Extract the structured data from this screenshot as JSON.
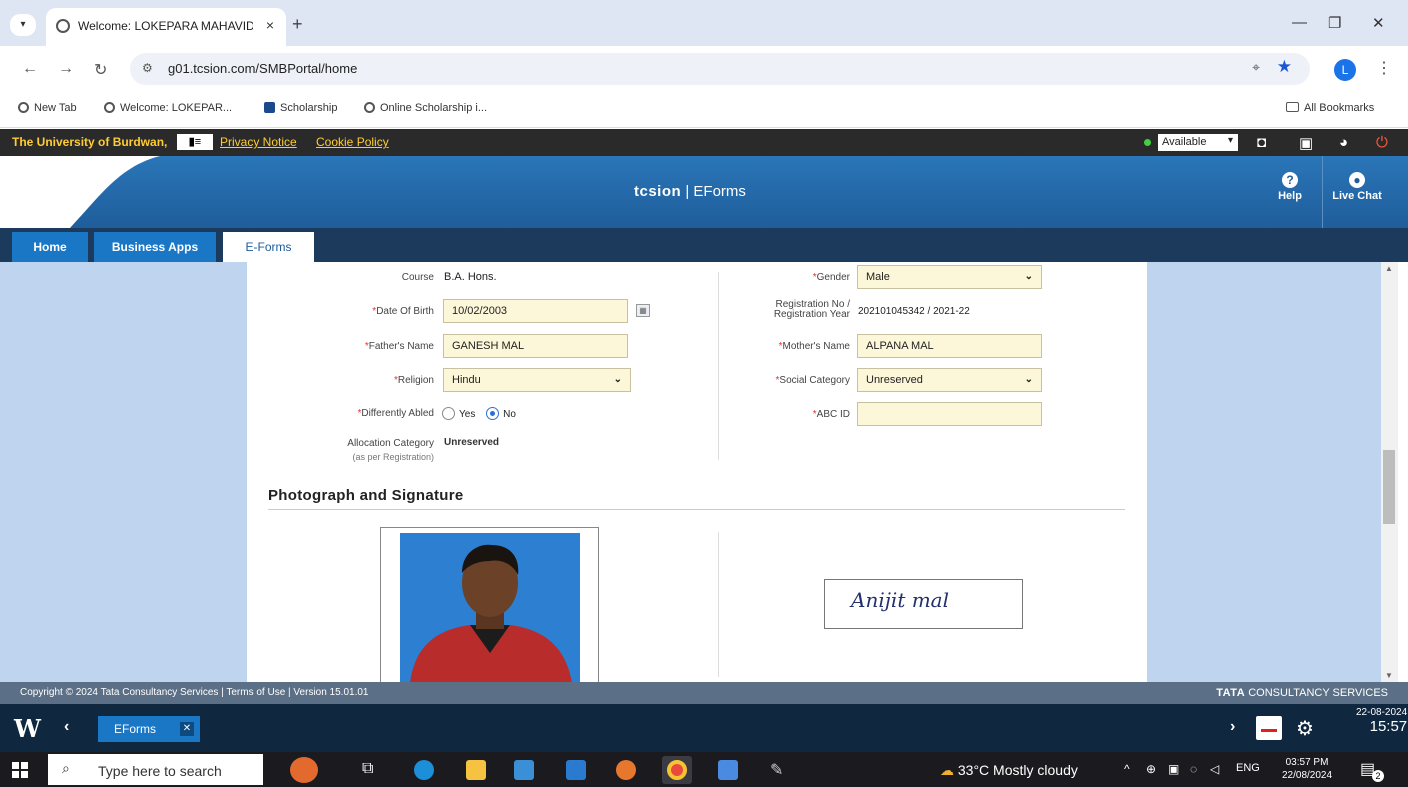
{
  "browser": {
    "tab_title": "Welcome: LOKEPARA MAHAVID",
    "tab_close": "×",
    "new_tab": "+",
    "url": "g01.tcsion.com/SMBPortal/home",
    "profile_initial": "L",
    "bookmarks": [
      "New Tab",
      "Welcome: LOKEPAR...",
      "Scholarship",
      "Online Scholarship i..."
    ],
    "all_bookmarks": "All Bookmarks"
  },
  "portal_bar": {
    "university": "The University of Burdwan,",
    "privacy": "Privacy Notice",
    "cookie": "Cookie Policy",
    "status": "Available"
  },
  "header": {
    "brand": "tcsion",
    "product": "| EForms",
    "help": "Help",
    "live_chat": "Live Chat"
  },
  "tabs": [
    "Home",
    "Business Apps",
    "E-Forms"
  ],
  "form": {
    "course_label": "Course",
    "course_value": "B.A. Hons.",
    "dob_label": "Date Of Birth",
    "dob_value": "10/02/2003",
    "father_label": "Father's Name",
    "father_value": "GANESH MAL",
    "religion_label": "Religion",
    "religion_value": "Hindu",
    "diff_label": "Differently Abled",
    "diff_yes": "Yes",
    "diff_no": "No",
    "alloc_label": "Allocation Category",
    "alloc_sub": "(as per Registration)",
    "alloc_value": "Unreserved",
    "gender_label": "Gender",
    "gender_value": "Male",
    "regno_label1": "Registration No /",
    "regno_label2": "Registration Year",
    "regno_value": "202101045342 / 2021-22",
    "mother_label": "Mother's Name",
    "mother_value": "ALPANA MAL",
    "social_label": "Social Category",
    "social_value": "Unreserved",
    "abc_label": "ABC ID",
    "abc_value": ""
  },
  "section_title": "Photograph and Signature",
  "signature_text": "Anijit mal",
  "footer": {
    "copyright": "Copyright © 2024 Tata Consultancy Services | Terms of Use | Version 15.01.01",
    "tcs_bold": "TATA",
    "tcs_rest": " CONSULTANCY SERVICES"
  },
  "app_taskbar": {
    "tab_label": "EForms",
    "date": "22-08-2024",
    "time": "15:57"
  },
  "win_taskbar": {
    "search_placeholder": "Type here to search",
    "weather": "33°C  Mostly cloudy",
    "lang": "ENG",
    "time": "03:57 PM",
    "date": "22/08/2024",
    "notif_count": "2"
  }
}
